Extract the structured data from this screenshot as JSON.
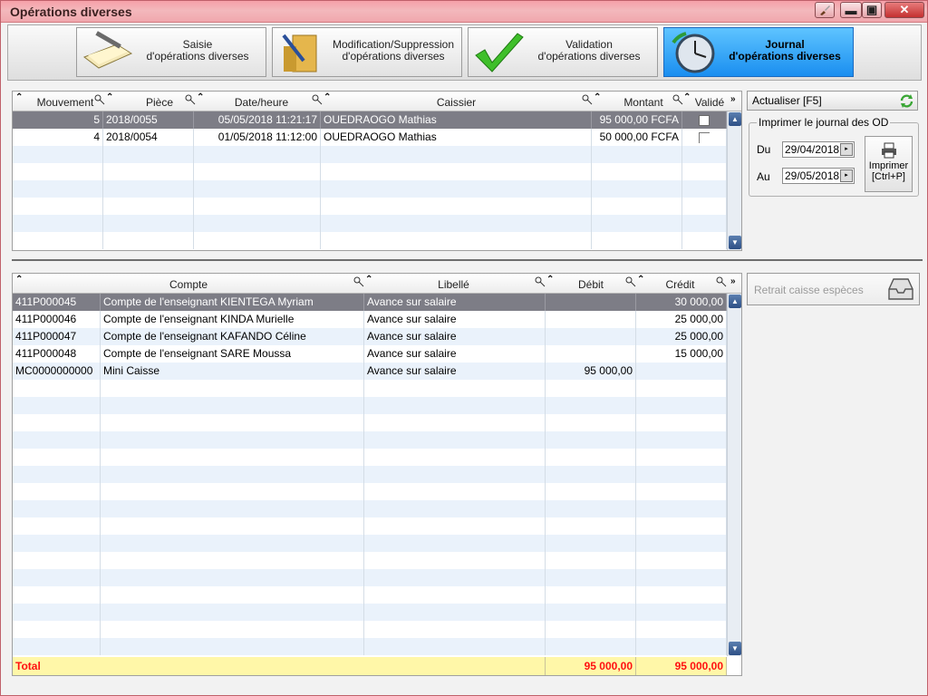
{
  "window": {
    "title": "Opérations diverses"
  },
  "toolbar": {
    "buttons": [
      {
        "label_line1": "Saisie",
        "label_line2": "d'opérations diverses"
      },
      {
        "label_line1": "Modification/Suppression",
        "label_line2": "d'opérations diverses"
      },
      {
        "label_line1": "Validation",
        "label_line2": "d'opérations diverses"
      },
      {
        "label_line1": "Journal",
        "label_line2": "d'opérations diverses",
        "active": true
      }
    ]
  },
  "top_grid": {
    "columns": [
      "Mouvement",
      "Pièce",
      "Date/heure",
      "Caissier",
      "Montant",
      "Validé"
    ],
    "rows": [
      {
        "mouvement": "5",
        "piece": "2018/0055",
        "datetime": "05/05/2018 11:21:17",
        "caissier": "OUEDRAOGO Mathias",
        "montant": "95 000,00 FCFA",
        "valide": false
      },
      {
        "mouvement": "4",
        "piece": "2018/0054",
        "datetime": "01/05/2018 11:12:00",
        "caissier": "OUEDRAOGO Mathias",
        "montant": "50 000,00 FCFA",
        "valide": false
      }
    ]
  },
  "side": {
    "refresh_label": "Actualiser [F5]",
    "print_group_label": "Imprimer le journal des OD",
    "du_label": "Du",
    "au_label": "Au",
    "date_from": "29/04/2018",
    "date_to": "29/05/2018",
    "print_label_line1": "Imprimer",
    "print_label_line2": "[Ctrl+P]",
    "retrait_label": "Retrait caisse espèces"
  },
  "bottom_grid": {
    "columns": [
      "Compte",
      "Libellé",
      "Débit",
      "Crédit"
    ],
    "rows": [
      {
        "code": "411P000045",
        "compte": "Compte de l'enseignant KIENTEGA Myriam",
        "libelle": "Avance sur salaire",
        "debit": "",
        "credit": "30 000,00"
      },
      {
        "code": "411P000046",
        "compte": "Compte de l'enseignant KINDA Murielle",
        "libelle": "Avance sur salaire",
        "debit": "",
        "credit": "25 000,00"
      },
      {
        "code": "411P000047",
        "compte": "Compte de l'enseignant KAFANDO Céline",
        "libelle": "Avance sur salaire",
        "debit": "",
        "credit": "25 000,00"
      },
      {
        "code": "411P000048",
        "compte": "Compte de l'enseignant SARE Moussa",
        "libelle": "Avance sur salaire",
        "debit": "",
        "credit": "15 000,00"
      },
      {
        "code": "MC0000000000",
        "compte": "Mini Caisse",
        "libelle": "Avance sur salaire",
        "debit": "95 000,00",
        "credit": ""
      }
    ],
    "total_label": "Total",
    "total_debit": "95 000,00",
    "total_credit": "95 000,00"
  },
  "colors": {
    "titlebar": "#f3b8bc",
    "active_button": "#1a8ef0",
    "selected_row": "#7d7d86",
    "total_row": "#fff7a8",
    "total_text": "#ff1010"
  }
}
